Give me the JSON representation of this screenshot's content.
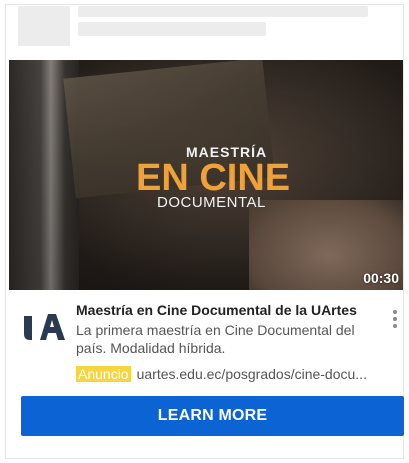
{
  "video": {
    "title_top": "MAESTRÍA",
    "title_main": "EN CINE",
    "title_bottom": "DOCUMENTAL",
    "duration": "00:30"
  },
  "ad": {
    "logo_icon": "uartes-logo-icon",
    "title": "Maestría en Cine Documental de la UArtes",
    "description": "La primera maestría en Cine Documental del país. Modalidad híbrida.",
    "badge": "Anuncio",
    "url": "uartes.edu.ec/posgrados/cine-docu...",
    "cta": "LEARN MORE"
  },
  "colors": {
    "cta_background": "#0b63d4",
    "badge_background": "#f7d540",
    "title_accent": "#f0a23a"
  }
}
